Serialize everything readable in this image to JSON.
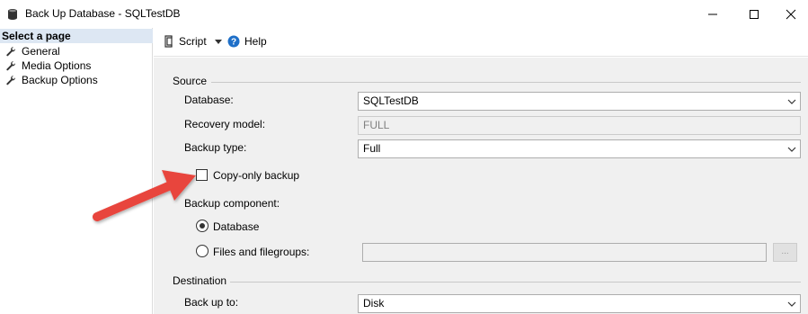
{
  "window": {
    "title": "Back Up Database - SQLTestDB",
    "minimize_icon": "minimize-icon",
    "maximize_icon": "maximize-icon",
    "close_icon": "close-icon"
  },
  "left_pane": {
    "header": "Select a page",
    "items": [
      {
        "label": "General",
        "icon": "wrench-icon",
        "selected": true
      },
      {
        "label": "Media Options",
        "icon": "wrench-icon",
        "selected": false
      },
      {
        "label": "Backup Options",
        "icon": "wrench-icon",
        "selected": false
      }
    ]
  },
  "toolbar": {
    "script_label": "Script",
    "help_label": "Help"
  },
  "source": {
    "section_label": "Source",
    "database_label": "Database:",
    "database_value": "SQLTestDB",
    "recovery_label": "Recovery model:",
    "recovery_value": "FULL",
    "backup_type_label": "Backup type:",
    "backup_type_value": "Full",
    "copy_only_label": "Copy-only backup",
    "copy_only_checked": false,
    "component_label": "Backup component:",
    "radio_database_label": "Database",
    "radio_files_label": "Files and filegroups:",
    "ellipsis_label": "..."
  },
  "destination": {
    "section_label": "Destination",
    "backup_to_label": "Back up to:",
    "backup_to_value": "Disk"
  },
  "colors": {
    "arrow": "#e8453c",
    "selected_header": "#dde7f3",
    "content_bg": "#f0f0f0"
  }
}
